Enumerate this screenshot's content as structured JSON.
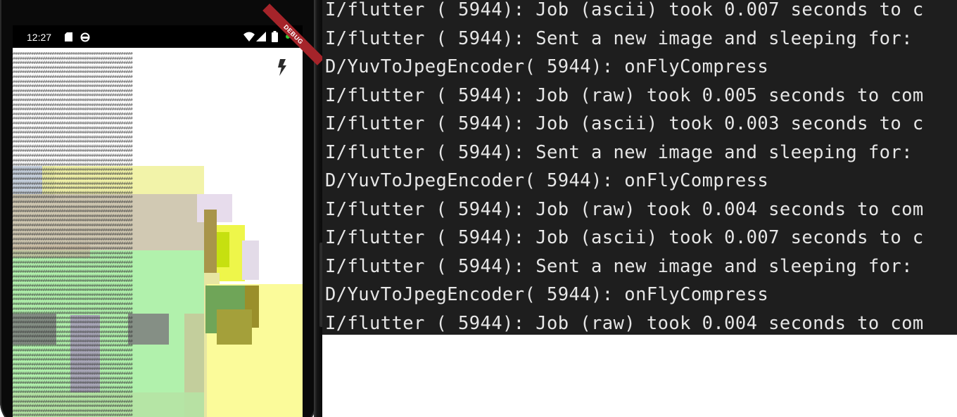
{
  "phone": {
    "status_bar": {
      "time": "12:27",
      "icons": [
        "sd-card-icon",
        "sync-icon",
        "wifi-icon",
        "signal-icon",
        "battery-icon",
        "notification-dot-icon"
      ]
    },
    "debug_banner": "DEBUG",
    "flash_button_icon": "flash-icon",
    "ascii_row": "####################################################"
  },
  "terminal": {
    "lines": [
      "I/flutter ( 5944): Job (ascii) took 0.007 seconds to c",
      "I/flutter ( 5944): Sent a new image and sleeping for: ",
      "D/YuvToJpegEncoder( 5944): onFlyCompress",
      "I/flutter ( 5944): Job (raw) took 0.005 seconds to com",
      "I/flutter ( 5944): Job (ascii) took 0.003 seconds to c",
      "I/flutter ( 5944): Sent a new image and sleeping for: ",
      "D/YuvToJpegEncoder( 5944): onFlyCompress",
      "I/flutter ( 5944): Job (raw) took 0.004 seconds to com",
      "I/flutter ( 5944): Job (ascii) took 0.007 seconds to c",
      "I/flutter ( 5944): Sent a new image and sleeping for: ",
      "D/YuvToJpegEncoder( 5944): onFlyCompress",
      "I/flutter ( 5944): Job (raw) took 0.004 seconds to com"
    ]
  },
  "colors": {
    "terminal_bg": "#1e1e1e",
    "terminal_text": "#e6e6e6",
    "debug_banner": "#a5242a",
    "camera_green": "#a8f0a0",
    "camera_yellow": "#fafa90"
  }
}
